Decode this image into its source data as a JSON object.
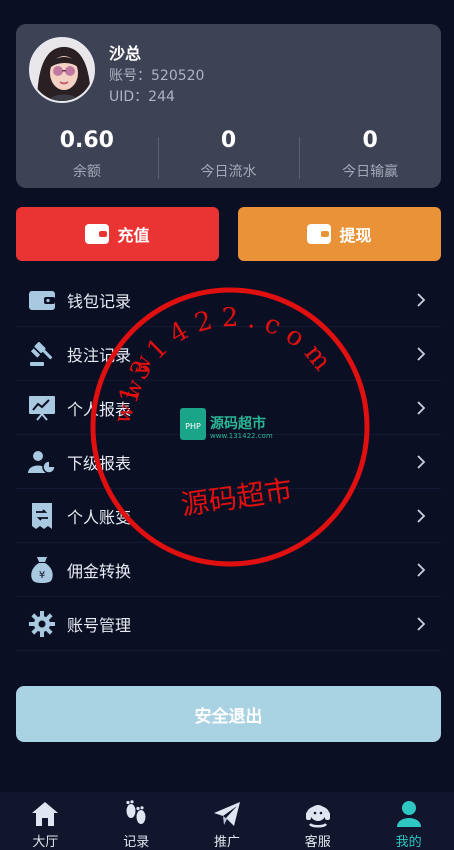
{
  "profile": {
    "name": "沙总",
    "account_label": "账号：",
    "account_value": "520520",
    "uid_label": "UID：",
    "uid_value": "244"
  },
  "stats": [
    {
      "value": "0.60",
      "label": "余额"
    },
    {
      "value": "0",
      "label": "今日流水"
    },
    {
      "value": "0",
      "label": "今日输赢"
    }
  ],
  "actions": {
    "recharge_label": "充值",
    "withdraw_label": "提现"
  },
  "menu": [
    {
      "label": "钱包记录",
      "icon": "wallet-icon"
    },
    {
      "label": "投注记录",
      "icon": "gavel-icon"
    },
    {
      "label": "个人报表",
      "icon": "chart-board-icon"
    },
    {
      "label": "下级报表",
      "icon": "user-pie-icon"
    },
    {
      "label": "个人账变",
      "icon": "receipt-icon"
    },
    {
      "label": "佣金转换",
      "icon": "money-bag-icon"
    },
    {
      "label": "账号管理",
      "icon": "gear-icon"
    }
  ],
  "logout_label": "安全退出",
  "tabs": [
    {
      "label": "大厅",
      "icon": "home-icon"
    },
    {
      "label": "记录",
      "icon": "footprints-icon"
    },
    {
      "label": "推广",
      "icon": "paper-plane-icon"
    },
    {
      "label": "客服",
      "icon": "headset-icon"
    },
    {
      "label": "我的",
      "icon": "person-icon"
    }
  ],
  "watermark": {
    "ring_text": "1 3 1 4 2 2 . c o m",
    "prefix": "w w w",
    "brand": "源码超市",
    "badge_name": "源码超市",
    "badge_url": "www.131422.com",
    "badge_tag": "PHP"
  },
  "colors": {
    "background": "#0b0f23",
    "card": "#3d4254",
    "recharge": "#e93433",
    "withdraw": "#ea9238",
    "logout": "#a9d2e2",
    "active_tab": "#2ec7c1",
    "icon": "#a9c9e0",
    "watermark": "#e01010"
  }
}
